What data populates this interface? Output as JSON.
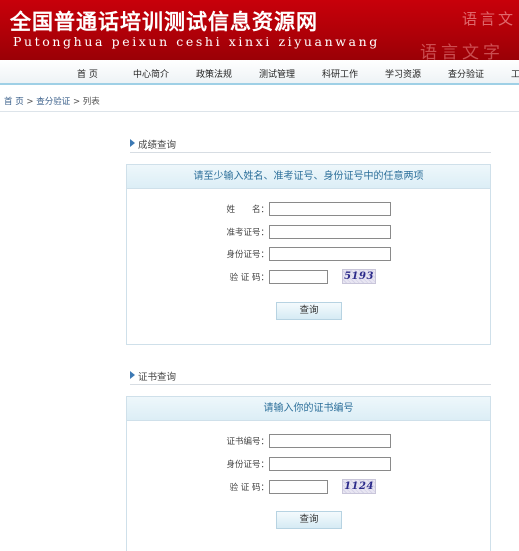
{
  "header": {
    "title": "全国普通话培训测试信息资源网",
    "pinyin": "Putonghua peixun ceshi xinxi ziyuanwang",
    "watermark_top": "语言文",
    "watermark_bottom": "语言文字"
  },
  "nav": {
    "items": [
      "首 页",
      "中心简介",
      "政策法规",
      "测试管理",
      "科研工作",
      "学习资源",
      "查分验证",
      "工"
    ]
  },
  "breadcrumb": {
    "home": "首 页",
    "sep1": " > ",
    "section": "查分验证",
    "sep2": " > ",
    "current": "列表"
  },
  "score_query": {
    "section_title": "成绩查询",
    "panel_title": "请至少输入姓名、准考证号、身份证号中的任意两项",
    "name_label": "姓　　名：",
    "name_value": "",
    "exam_no_label": "准考证号：",
    "exam_no_value": "",
    "id_label": "身份证号：",
    "id_value": "",
    "captcha_label": "验 证 码：",
    "captcha_value": "",
    "captcha_code": "5193",
    "submit_label": "查询"
  },
  "cert_query": {
    "section_title": "证书查询",
    "panel_title": "请输入你的证书编号",
    "cert_no_label": "证书编号：",
    "cert_no_value": "",
    "id_label": "身份证号：",
    "id_value": "",
    "captcha_label": "验 证 码：",
    "captcha_value": "",
    "captcha_code": "1124",
    "submit_label": "查询"
  }
}
